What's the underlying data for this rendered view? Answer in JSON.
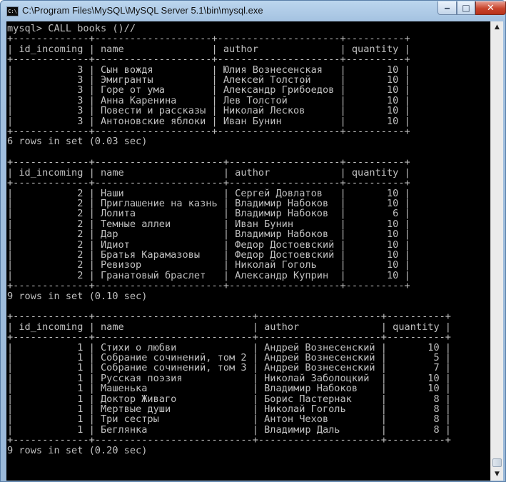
{
  "window": {
    "title": "C:\\Program Files\\MySQL\\MySQL Server 5.1\\bin\\mysql.exe",
    "icon_label": "C:\\",
    "buttons": {
      "minimize": "minimize-icon",
      "maximize": "maximize-icon",
      "close": "close-icon"
    }
  },
  "console": {
    "background": "#000000",
    "text_color": "#c0c0c0",
    "prompt": "mysql> CALL books ()//",
    "results": [
      {
        "columns": [
          "id_incoming",
          "name",
          "author",
          "quantity"
        ],
        "rows": [
          [
            "3",
            "Сын вождя",
            "Юлия Вознесенская",
            "10"
          ],
          [
            "3",
            "Эмигранты",
            "Алексей Толстой",
            "10"
          ],
          [
            "3",
            "Горе от ума",
            "Александр Грибоедов",
            "10"
          ],
          [
            "3",
            "Анна Каренина",
            "Лев Толстой",
            "10"
          ],
          [
            "3",
            "Повести и рассказы",
            "Николай Лесков",
            "10"
          ],
          [
            "3",
            "Антоновские яблоки",
            "Иван Бунин",
            "10"
          ]
        ],
        "footer": "6 rows in set (0.03 sec)"
      },
      {
        "columns": [
          "id_incoming",
          "name",
          "author",
          "quantity"
        ],
        "rows": [
          [
            "2",
            "Наши",
            "Сергей Довлатов",
            "10"
          ],
          [
            "2",
            "Приглашение на казнь",
            "Владимир Набоков",
            "10"
          ],
          [
            "2",
            "Лолита",
            "Владимир Набоков",
            "6"
          ],
          [
            "2",
            "Темные аллеи",
            "Иван Бунин",
            "10"
          ],
          [
            "2",
            "Дар",
            "Владимир Набоков",
            "10"
          ],
          [
            "2",
            "Идиот",
            "Федор Достоевский",
            "10"
          ],
          [
            "2",
            "Братья Карамазовы",
            "Федор Достоевский",
            "10"
          ],
          [
            "2",
            "Ревизор",
            "Николай Гоголь",
            "10"
          ],
          [
            "2",
            "Гранатовый браслет",
            "Александр Куприн",
            "10"
          ]
        ],
        "footer": "9 rows in set (0.10 sec)"
      },
      {
        "columns": [
          "id_incoming",
          "name",
          "author",
          "quantity"
        ],
        "rows": [
          [
            "1",
            "Стихи о любви",
            "Андрей Вознесенский",
            "10"
          ],
          [
            "1",
            "Собрание сочинений, том 2",
            "Андрей Вознесенский",
            "5"
          ],
          [
            "1",
            "Собрание сочинений, том 3",
            "Андрей Вознесенский",
            "7"
          ],
          [
            "1",
            "Русская поэзия",
            "Николай Заболоцкий",
            "10"
          ],
          [
            "1",
            "Машенька",
            "Владимир Набоков",
            "10"
          ],
          [
            "1",
            "Доктор Живаго",
            "Борис Пастернак",
            "8"
          ],
          [
            "1",
            "Мертвые души",
            "Николай Гоголь",
            "8"
          ],
          [
            "1",
            "Три сестры",
            "Антон Чехов",
            "8"
          ],
          [
            "1",
            "Беглянка",
            "Владимир Даль",
            "8"
          ]
        ],
        "footer": "9 rows in set (0.20 sec)"
      }
    ]
  },
  "scrollbar": {
    "up": "scroll-up-arrow-icon",
    "down": "scroll-down-arrow-icon"
  }
}
